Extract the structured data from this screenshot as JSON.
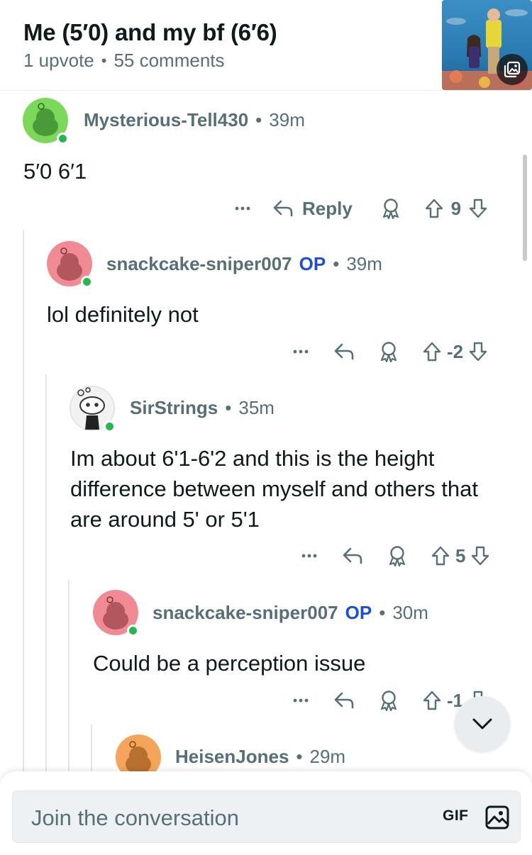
{
  "post": {
    "title": "Me (5′0) and my bf (6′6)",
    "upvotes": "1 upvote",
    "separator": "•",
    "comments": "55 comments"
  },
  "comments": [
    {
      "user": "Mysterious-Tell430",
      "op": "",
      "time": "39m",
      "body": "5′0 6′1",
      "reply_label": "Reply",
      "score": "9",
      "avatar_color": "#7bd85a",
      "avatar_icon": "snoo-avatar-green"
    },
    {
      "user": "snackcake-sniper007",
      "op": "OP",
      "time": "39m",
      "body": "lol definitely not",
      "reply_label": "",
      "score": "-2",
      "avatar_color": "#f08b94",
      "avatar_icon": "snoo-avatar-pink"
    },
    {
      "user": "SirStrings",
      "op": "",
      "time": "35m",
      "body": "Im about 6'1-6'2 and this is the height difference between myself and others that are around 5' or 5'1",
      "reply_label": "",
      "score": "5",
      "avatar_color": "#eeeeee",
      "avatar_icon": "snoo-avatar-custom"
    },
    {
      "user": "snackcake-sniper007",
      "op": "OP",
      "time": "30m",
      "body": "Could be a perception issue",
      "reply_label": "",
      "score": "-1",
      "avatar_color": "#f08b94",
      "avatar_icon": "snoo-avatar-pink"
    },
    {
      "user": "HeisenJones",
      "op": "",
      "time": "29m",
      "body": "",
      "reply_label": "",
      "score": "",
      "avatar_color": "#f5a55a",
      "avatar_icon": "snoo-avatar-orange"
    }
  ],
  "composer": {
    "placeholder": "Join the conversation",
    "gif_label": "GIF"
  },
  "icons": {
    "more": "more-dots-icon",
    "reply": "reply-arrow-icon",
    "award": "award-icon",
    "upvote": "upvote-arrow-icon",
    "downvote": "downvote-arrow-icon",
    "scroll_down": "chevron-down-icon",
    "image": "image-icon",
    "gallery": "gallery-icon"
  },
  "colors": {
    "meta_gray": "#576f76",
    "op_blue": "#1d4ed8",
    "online_green": "#25b84e",
    "thread_line": "#e3e6e8"
  }
}
